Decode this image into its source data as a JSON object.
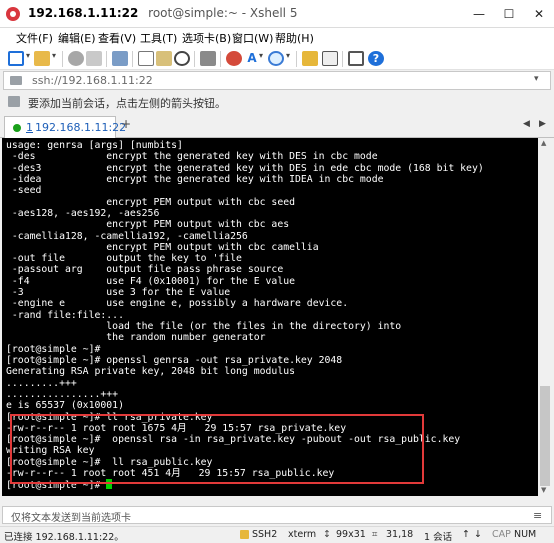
{
  "window": {
    "host": "192.168.1.11:22",
    "title_rest": "root@simple:~ - Xshell 5",
    "buttons": [
      "—",
      "☐",
      "✕"
    ]
  },
  "menu": [
    "文件(F)",
    "编辑(E)",
    "查看(V)",
    "工具(T)",
    "选项卡(B)",
    "窗口(W)",
    "帮助(H)"
  ],
  "toolbar": {
    "icons": [
      "new-session-icon",
      "open-folder-icon",
      "connect-icon",
      "disconnect-icon",
      "properties-icon",
      "copy-icon",
      "paste-icon",
      "find-icon",
      "print-icon",
      "color-scheme-icon",
      "font-icon",
      "globe-icon",
      "lock-icon",
      "keyboard-icon",
      "fullscreen-icon",
      "help-icon"
    ],
    "accent": "#1e6fd9"
  },
  "address": {
    "value": "ssh://192.168.1.11:22"
  },
  "hint": {
    "text": "要添加当前会话，点击左侧的箭头按钮。"
  },
  "tabs": [
    {
      "index": "1",
      "label": "192.168.1.11:22",
      "active": true
    }
  ],
  "tab_nav": {
    "prev": "◀",
    "next": "▶",
    "add": "+"
  },
  "terminal": {
    "lines": [
      "usage: genrsa [args] [numbits]",
      " -des            encrypt the generated key with DES in cbc mode",
      " -des3           encrypt the generated key with DES in ede cbc mode (168 bit key)",
      " -idea           encrypt the generated key with IDEA in cbc mode",
      " -seed",
      "                 encrypt PEM output with cbc seed",
      " -aes128, -aes192, -aes256",
      "                 encrypt PEM output with cbc aes",
      " -camellia128, -camellia192, -camellia256",
      "                 encrypt PEM output with cbc camellia",
      " -out file       output the key to 'file",
      " -passout arg    output file pass phrase source",
      " -f4             use F4 (0x10001) for the E value",
      " -3              use 3 for the E value",
      " -engine e       use engine e, possibly a hardware device.",
      " -rand file:file:...",
      "                 load the file (or the files in the directory) into",
      "                 the random number generator",
      "[root@simple ~]# ",
      "[root@simple ~]# openssl genrsa -out rsa_private.key 2048",
      "Generating RSA private key, 2048 bit long modulus",
      ".........+++",
      "................+++",
      "e is 65537 (0x10001)",
      "[root@simple ~]# ll rsa_private.key",
      "-rw-r--r-- 1 root root 1675 4月   29 15:57 rsa_private.key",
      "[root@simple ~]#  openssl rsa -in rsa_private.key -pubout -out rsa_public.key",
      "writing RSA key",
      "[root@simple ~]#  ll rsa_public.key",
      "-rw-r--r-- 1 root root 451 4月   29 15:57 rsa_public.key",
      "[root@simple ~]# "
    ],
    "cursor_color": "#00d000",
    "highlight_color": "#e23a3a"
  },
  "composer": {
    "placeholder": "仅将文本发送到当前选项卡"
  },
  "status": {
    "connection": "已连接 192.168.1.11:22。",
    "protocol": "SSH2",
    "term": "xterm",
    "size": "99x31",
    "cursor_pos": "31,18",
    "sessions": "1 会话",
    "caps": "CAP",
    "num": "NUM"
  }
}
